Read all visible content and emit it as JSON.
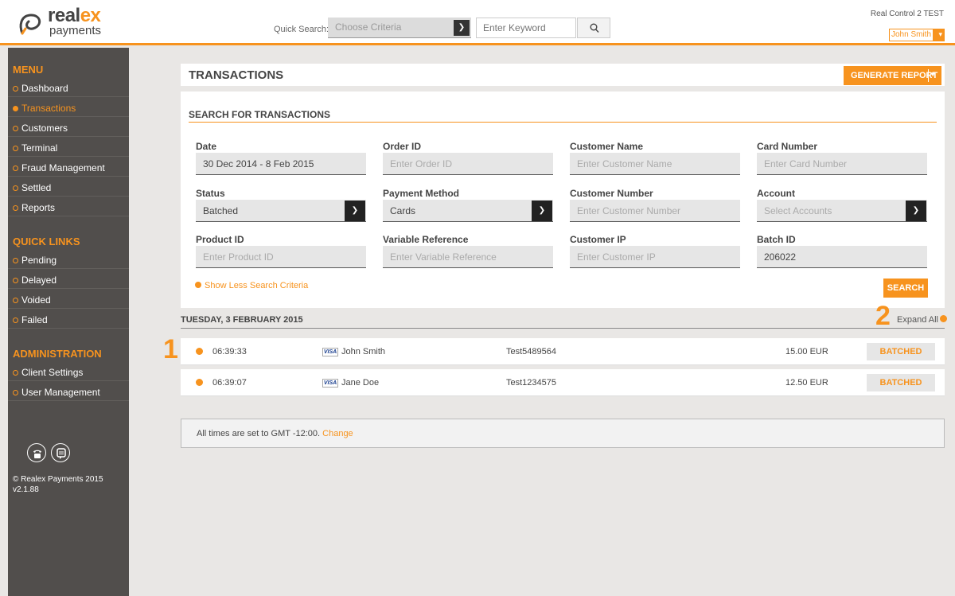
{
  "header": {
    "logo_brand_prefix": "real",
    "logo_brand_suffix": "ex",
    "logo_sub": "payments",
    "quick_search_label": "Quick Search:",
    "criteria_placeholder": "Choose Criteria",
    "keyword_placeholder": "Enter Keyword",
    "account_name": "Real Control 2 TEST",
    "user_name": "John Smith"
  },
  "sidebar": {
    "menu_title": "MENU",
    "menu_items": [
      {
        "label": "Dashboard",
        "active": false
      },
      {
        "label": "Transactions",
        "active": true
      },
      {
        "label": "Customers",
        "active": false
      },
      {
        "label": "Terminal",
        "active": false
      },
      {
        "label": "Fraud Management",
        "active": false
      },
      {
        "label": "Settled",
        "active": false
      },
      {
        "label": "Reports",
        "active": false
      }
    ],
    "quick_links_title": "QUICK LINKS",
    "quick_links": [
      {
        "label": "Pending"
      },
      {
        "label": "Delayed"
      },
      {
        "label": "Voided"
      },
      {
        "label": "Failed"
      }
    ],
    "admin_title": "ADMINISTRATION",
    "admin_items": [
      {
        "label": "Client Settings"
      },
      {
        "label": "User Management"
      }
    ],
    "copyright": "© Realex Payments 2015",
    "version": "v2.1.88"
  },
  "page": {
    "title": "TRANSACTIONS",
    "generate_report_label": "GENERATE REPORT"
  },
  "search": {
    "title": "SEARCH FOR TRANSACTIONS",
    "fields": {
      "date": {
        "label": "Date",
        "value": "30 Dec 2014 - 8 Feb 2015"
      },
      "order_id": {
        "label": "Order ID",
        "placeholder": "Enter Order ID"
      },
      "customer_name": {
        "label": "Customer Name",
        "placeholder": "Enter Customer Name"
      },
      "card_number": {
        "label": "Card Number",
        "placeholder": "Enter Card Number"
      },
      "status": {
        "label": "Status",
        "value": "Batched"
      },
      "payment_method": {
        "label": "Payment Method",
        "value": "Cards"
      },
      "customer_number": {
        "label": "Customer Number",
        "placeholder": "Enter Customer Number"
      },
      "account": {
        "label": "Account",
        "placeholder": "Select Accounts"
      },
      "product_id": {
        "label": "Product ID",
        "placeholder": "Enter Product ID"
      },
      "variable_reference": {
        "label": "Variable Reference",
        "placeholder": "Enter Variable Reference"
      },
      "customer_ip": {
        "label": "Customer IP",
        "placeholder": "Enter Customer IP"
      },
      "batch_id": {
        "label": "Batch ID",
        "value": "206022"
      }
    },
    "show_less_label": "Show Less Search Criteria",
    "search_button_label": "SEARCH"
  },
  "results": {
    "day_heading": "TUESDAY, 3 FEBRUARY 2015",
    "expand_all_label": "Expand All",
    "markers": [
      "1",
      "2"
    ],
    "rows": [
      {
        "time": "06:39:33",
        "card": "VISA",
        "customer": "John Smith",
        "order_id": "Test5489564",
        "amount": "15.00 EUR",
        "status": "BATCHED"
      },
      {
        "time": "06:39:07",
        "card": "VISA",
        "customer": "Jane Doe",
        "order_id": "Test1234575",
        "amount": "12.50 EUR",
        "status": "BATCHED"
      }
    ]
  },
  "footer": {
    "timezone_text": "All times are set to GMT -12:00.",
    "change_link": "Change"
  },
  "colors": {
    "accent": "#f7931e",
    "sidebar_bg": "#514e4c",
    "page_bg": "#e9e7e5"
  }
}
